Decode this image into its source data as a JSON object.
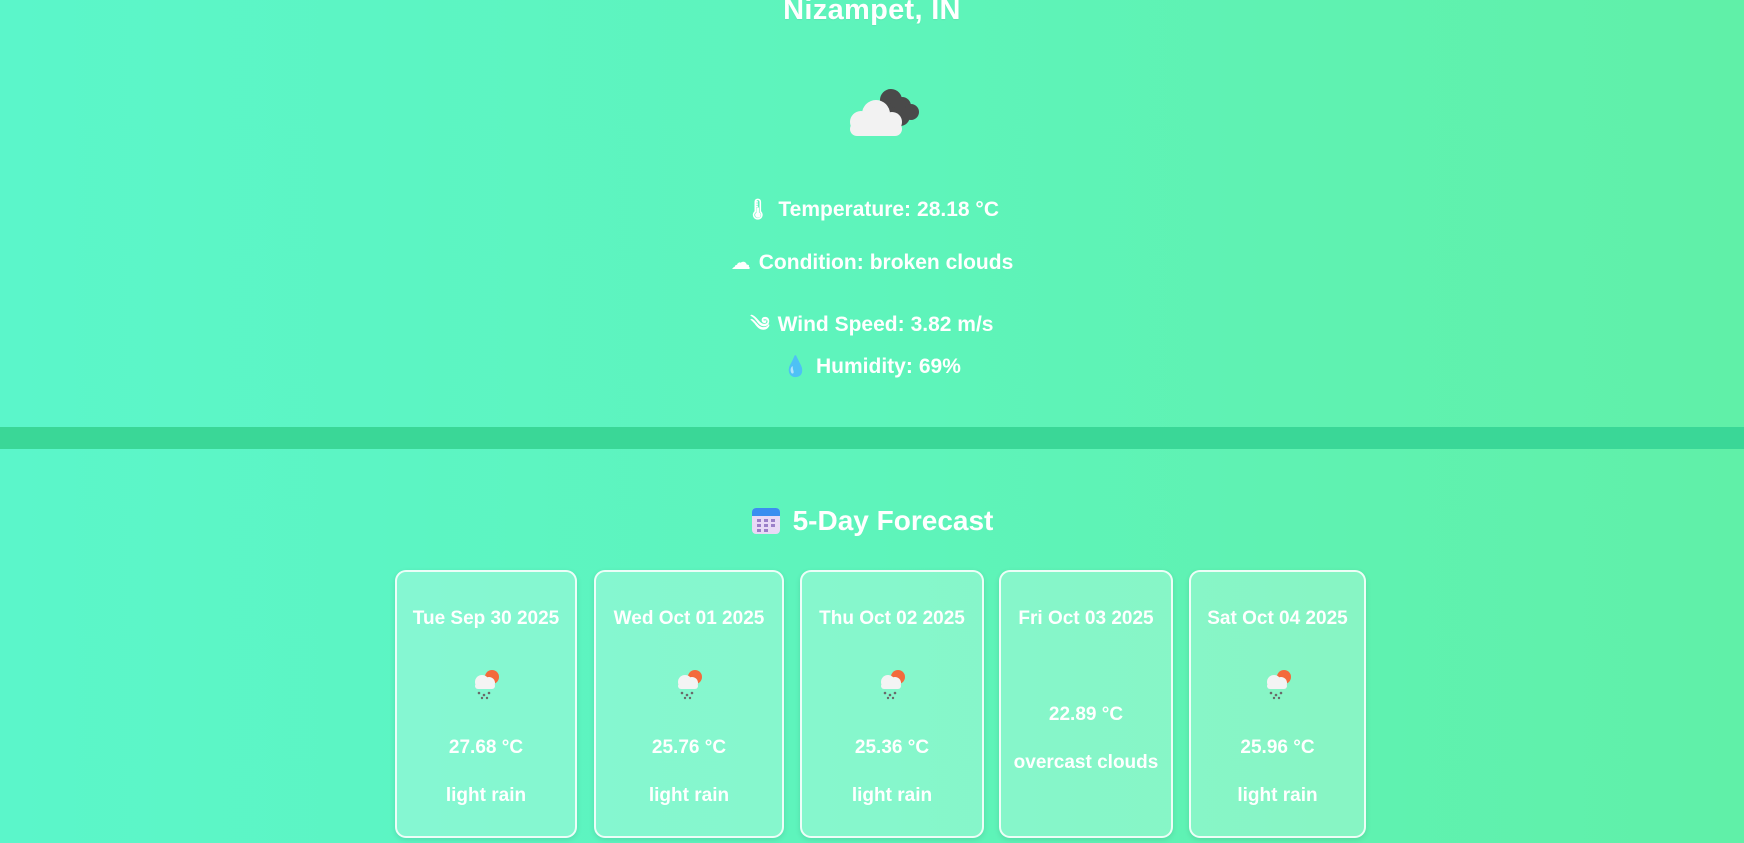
{
  "current": {
    "location": "Nizampet, IN",
    "icon": "broken-clouds-icon",
    "stats": [
      {
        "icon": "thermometer-icon",
        "label": "Temperature:",
        "value": "28.18 °C"
      },
      {
        "icon": "cloud-icon",
        "label": "Condition:",
        "value": "broken clouds"
      },
      {
        "icon": "wind-icon",
        "label": "Wind Speed:",
        "value": "3.82 m/s"
      },
      {
        "icon": "droplet-icon",
        "label": "Humidity:",
        "value": "69%"
      }
    ]
  },
  "forecast": {
    "title": "5-Day Forecast",
    "title_icon": "calendar-icon",
    "days": [
      {
        "date": "Tue Sep 30 2025",
        "icon": "rain-sun-icon",
        "temp": "27.68 °C",
        "desc": "light rain"
      },
      {
        "date": "Wed Oct 01 2025",
        "icon": "rain-sun-icon",
        "temp": "25.76 °C",
        "desc": "light rain"
      },
      {
        "date": "Thu Oct 02 2025",
        "icon": "rain-sun-icon",
        "temp": "25.36 °C",
        "desc": "light rain"
      },
      {
        "date": "Fri Oct 03 2025",
        "icon": "",
        "temp": "22.89 °C",
        "desc": "overcast clouds"
      },
      {
        "date": "Sat Oct 04 2025",
        "icon": "rain-sun-icon",
        "temp": "25.96 °C",
        "desc": "light rain"
      }
    ]
  },
  "colors": {
    "background_start": "#5bf6ca",
    "background_end": "#60f0a8",
    "divider": "#3ad797",
    "text": "#ffffff"
  }
}
